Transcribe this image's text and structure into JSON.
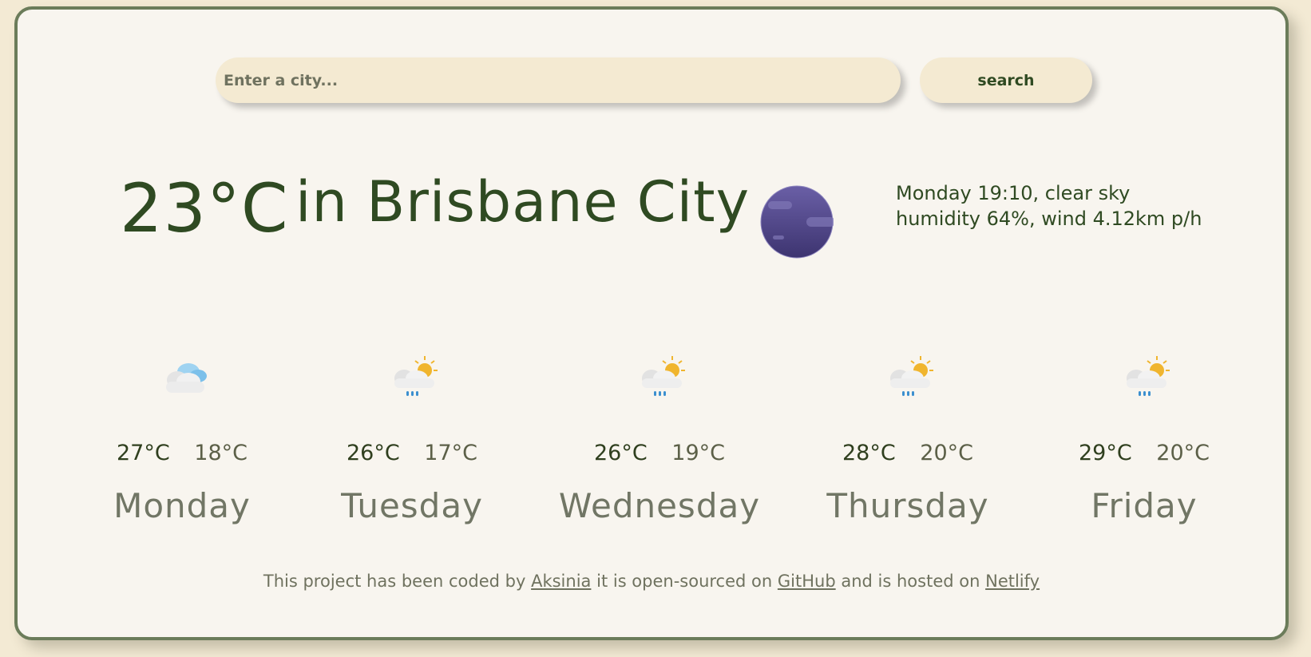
{
  "search": {
    "placeholder": "Enter a city...",
    "button_label": "search"
  },
  "current": {
    "temperature": "23°C",
    "city": "in Brisbane City",
    "icon": "clear-night-moon-icon",
    "description_line": "Monday 19:10, clear sky",
    "humidity_wind_line": "humidity 64%, wind 4.12km p/h"
  },
  "forecast": [
    {
      "day": "Monday",
      "max": "27°C",
      "min": "18°C",
      "icon": "cloudy-icon"
    },
    {
      "day": "Tuesday",
      "max": "26°C",
      "min": "17°C",
      "icon": "sun-cloud-rain-icon"
    },
    {
      "day": "Wednesday",
      "max": "26°C",
      "min": "19°C",
      "icon": "sun-cloud-rain-icon"
    },
    {
      "day": "Thursday",
      "max": "28°C",
      "min": "20°C",
      "icon": "sun-cloud-rain-icon"
    },
    {
      "day": "Friday",
      "max": "29°C",
      "min": "20°C",
      "icon": "sun-cloud-rain-icon"
    }
  ],
  "footer": {
    "text1": "This project has been coded by",
    "link1": "Aksinia",
    "text2": "it is open-sourced on",
    "link2": "GitHub",
    "text3": "and is hosted on",
    "link3": "Netlify"
  },
  "colors": {
    "page_background": "#f3ead4",
    "card_background": "#f8f5ef",
    "accent_green": "#2f4a22",
    "border_green": "#6b7c5a",
    "input_background": "#f4ead2"
  }
}
